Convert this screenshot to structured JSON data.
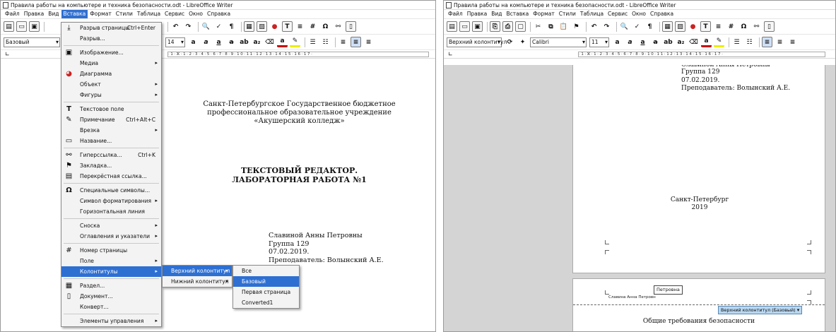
{
  "window1": {
    "title": "Правила работы на компьютере и техника безопасности.odt - LibreOffice Writer",
    "menubar": [
      "Файл",
      "Правка",
      "Вид",
      "Вставка",
      "Формат",
      "Стили",
      "Таблица",
      "Сервис",
      "Окно",
      "Справка"
    ],
    "active_menu": "Вставка",
    "style_box": "Базовый",
    "font_size": "14",
    "document": {
      "header_lines": [
        "Санкт-Петербургское Государственное бюджетное",
        "профессиональное  образовательное учреждение",
        "«Акушерский колледж»"
      ],
      "title_lines": [
        "ТЕКСТОВЫЙ РЕДАКТОР.",
        "ЛАБОРАТОРНАЯ РАБОТА №1"
      ],
      "author_lines": [
        "Славиной Анны Петровны",
        "Группа 129",
        "07.02.2019.",
        "Преподаватель: Волынский А.Е."
      ]
    },
    "insert_menu": [
      {
        "label": "Разрыв страницы",
        "shortcut": "Ctrl+Enter",
        "icon": "page-break-icon"
      },
      {
        "label": "Разрыв...",
        "shortcut": "",
        "icon": ""
      },
      {
        "sep": true
      },
      {
        "label": "Изображение...",
        "shortcut": "",
        "icon": "image-icon"
      },
      {
        "label": "Медиа",
        "arrow": "▸",
        "icon": ""
      },
      {
        "label": "Диаграмма",
        "shortcut": "",
        "icon": "chart-icon"
      },
      {
        "label": "Объект",
        "arrow": "▸",
        "icon": ""
      },
      {
        "label": "Фигуры",
        "arrow": "▸",
        "icon": ""
      },
      {
        "sep": true
      },
      {
        "label": "Текстовое поле",
        "shortcut": "",
        "icon": "text-box-icon"
      },
      {
        "label": "Примечание",
        "shortcut": "Ctrl+Alt+C",
        "icon": "comment-icon"
      },
      {
        "label": "Врезка",
        "arrow": "▸",
        "icon": ""
      },
      {
        "label": "Название...",
        "shortcut": "",
        "icon": "caption-icon"
      },
      {
        "sep": true
      },
      {
        "label": "Гиперссылка...",
        "shortcut": "Ctrl+K",
        "icon": "hyperlink-icon"
      },
      {
        "label": "Закладка...",
        "shortcut": "",
        "icon": "bookmark-icon"
      },
      {
        "label": "Перекрёстная ссылка...",
        "shortcut": "",
        "icon": "cross-reference-icon"
      },
      {
        "sep": true
      },
      {
        "label": "Специальные символы...",
        "shortcut": "",
        "icon": "omega-icon"
      },
      {
        "label": "Символ форматирования",
        "arrow": "▸",
        "icon": ""
      },
      {
        "label": "Горизонтальная линия",
        "shortcut": "",
        "icon": ""
      },
      {
        "sep": true
      },
      {
        "label": "Сноска",
        "arrow": "▸",
        "icon": ""
      },
      {
        "label": "Оглавления и указатели",
        "arrow": "▸",
        "icon": ""
      },
      {
        "sep": true
      },
      {
        "label": "Номер страницы",
        "shortcut": "",
        "icon": "page-number-icon"
      },
      {
        "label": "Поле",
        "arrow": "▸",
        "icon": ""
      },
      {
        "label": "Колонтитулы",
        "arrow": "▸",
        "icon": "",
        "highlight": true
      },
      {
        "sep": true
      },
      {
        "label": "Раздел...",
        "shortcut": "",
        "icon": "section-icon"
      },
      {
        "label": "Документ...",
        "shortcut": "",
        "icon": "document-icon"
      },
      {
        "label": "Конверт...",
        "shortcut": "",
        "icon": ""
      },
      {
        "sep": true
      },
      {
        "label": "Элементы управления",
        "arrow": "▸",
        "icon": ""
      }
    ],
    "headers_submenu": [
      {
        "label": "Верхний колонтитул",
        "arrow": "▸",
        "highlight": true
      },
      {
        "label": "Нижний колонтитул",
        "arrow": "▸"
      }
    ],
    "header_submenu": [
      {
        "label": "Все"
      },
      {
        "label": "Базовый",
        "highlight": true
      },
      {
        "label": "Первая страница"
      },
      {
        "label": "Converted1"
      }
    ]
  },
  "window2": {
    "title": "Правила работы на компьютере и техника безопасности.odt - LibreOffice Writer",
    "menubar": [
      "Файл",
      "Правка",
      "Вид",
      "Вставка",
      "Формат",
      "Стили",
      "Таблица",
      "Сервис",
      "Окно",
      "Справка"
    ],
    "style_box": "Верхний колонтитул",
    "font_box": "Calibri",
    "font_size": "11",
    "document": {
      "top_lines": [
        "Славиной Анны Петровны",
        "Группа 129",
        "07.02.2019.",
        "Преподаватель: Волынский А.Е."
      ],
      "city_lines": [
        "Санкт-Петербург",
        "2019"
      ],
      "header_field": "Петровна",
      "header_text": "Славина Анна Петровн",
      "header_tag": "Верхний колонтитул (Базовый)",
      "heading": "Общие требования безопасности"
    }
  },
  "colors": {
    "menu_highlight": "#2e6fd2",
    "accent": "#2f6fd0"
  }
}
